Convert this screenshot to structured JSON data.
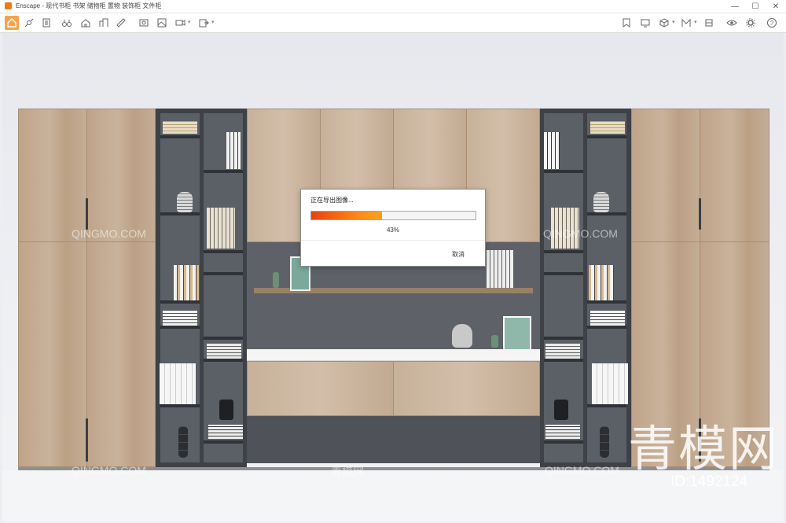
{
  "window": {
    "app_name": "Enscape",
    "title": "Enscape - 现代书柜 书架 储物柜 置物 装饰柜 文件柜",
    "minimize_glyph": "—",
    "maximize_glyph": "☐",
    "close_glyph": "✕"
  },
  "toolbar": {
    "left_icons": [
      "home-icon",
      "satellite-icon",
      "document-list-icon",
      "binoculars-icon",
      "house-icon",
      "buildings-icon",
      "ruler-icon",
      "screenshot-icon",
      "gallery-icon",
      "video-icon",
      "export-icon"
    ],
    "right_icons": [
      "bookmark-icon",
      "monitor-icon",
      "cube-icon",
      "material-icon",
      "asset-icon",
      "eye-settings-icon",
      "gear-icon",
      "help-icon"
    ],
    "help_label": "?"
  },
  "export_dialog": {
    "title": "正在导出图像...",
    "progress": 0.43,
    "progress_label": "43%",
    "cancel_label": "取消"
  },
  "watermarks": {
    "small": "QINGMO.COM",
    "small_cn": "青模网",
    "large": "青模网",
    "id_text": "ID:1492124"
  },
  "colors": {
    "accent": "#f07a16",
    "progress_start": "#e8400a",
    "progress_end": "#ffa21e",
    "wood": "#c4ad96",
    "cabinet_dark": "#3e4146"
  }
}
